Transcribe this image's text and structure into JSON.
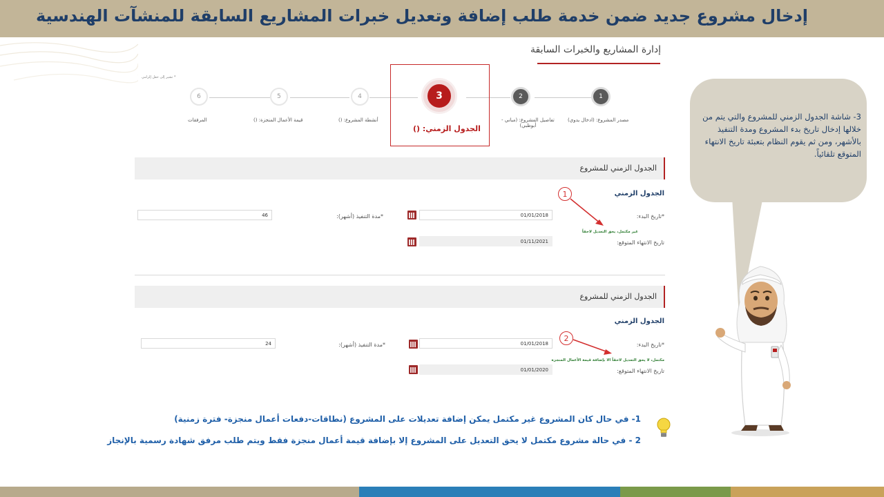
{
  "header": {
    "title": "إدخال مشروع جديد ضمن خدمة طلب إضافة وتعديل خبرات المشاريع السابقة للمنشآت الهندسية"
  },
  "page": {
    "section_title": "إدارة المشاريع والخبرات السابقة",
    "hint_text": "* تشير إلى حقل إلزامي"
  },
  "stepper": {
    "steps": [
      {
        "number": "1",
        "label": "مصدر المشروع: (ادخال يدوي)"
      },
      {
        "number": "2",
        "label_line1": "تفاصيل المشروع: (مباني -",
        "label_line2": "أبوظبي)"
      },
      {
        "number": "3",
        "label": "الجدول الزمني: ()"
      },
      {
        "number": "4",
        "label": "أنشطة المشروع: ()"
      },
      {
        "number": "5",
        "label": "قيمة الأعمال المنجزة: ()"
      },
      {
        "number": "6",
        "label": "المرفقات"
      }
    ],
    "active_step": 3
  },
  "panel1": {
    "heading": "الجدول الزمني للمشروع",
    "subtitle": "الجدول الزمني",
    "start_label": "*تاريخ البدء:",
    "start_value": "01/01/2018",
    "duration_label": "*مدة التنفيذ (أشهر):",
    "duration_value": "46",
    "note": "غير مكتمل، يحق التعديل لاحقاً",
    "end_label": "تاريخ الانتهاء المتوقع:",
    "end_value": "01/11/2021",
    "badge": "1"
  },
  "panel2": {
    "heading": "الجدول الزمني للمشروع",
    "subtitle": "الجدول الزمني",
    "start_label": "*تاريخ البدء:",
    "start_value": "01/01/2018",
    "duration_label": "*مدة التنفيذ (أشهر):",
    "duration_value": "24",
    "note": "مكتمل، لا يحق التعديل لاحقاً الا بإضافة قيمة الأعمال المنجزة",
    "end_label": "تاريخ الانتهاء المتوقع:",
    "end_value": "01/01/2020",
    "badge": "2"
  },
  "bubble": {
    "text": "3- شاشة الجدول الزمني للمشروع والتي يتم من خلالها إدخال تاريخ بدء المشروع ومدة التنفيذ بالأشهر، ومن ثم يقوم النظام بتعبئة تاريخ الانتهاء المتوقع تلقائياً."
  },
  "notes": {
    "line1": "1- في حال كان المشروع غير مكتمل يمكن إضافة تعديلات على المشروع (نطاقات-دفعات أعمال منجزة- فترة زمنية)",
    "line2": "2 - في حالة مشروع مكتمل لا يحق التعديل على المشروع إلا بإضافة قيمة أعمال منجزة فقط ويتم طلب مرفق شهادة رسمية بالإنجاز"
  },
  "colors": {
    "title_bar": "#c2b598",
    "accent_red": "#b71c1c",
    "navy": "#1f3e68",
    "note_blue": "#1f5fa8",
    "footer": [
      "#b7aa8c",
      "#2a7fb8",
      "#7a9a4a",
      "#c9a25a"
    ]
  }
}
